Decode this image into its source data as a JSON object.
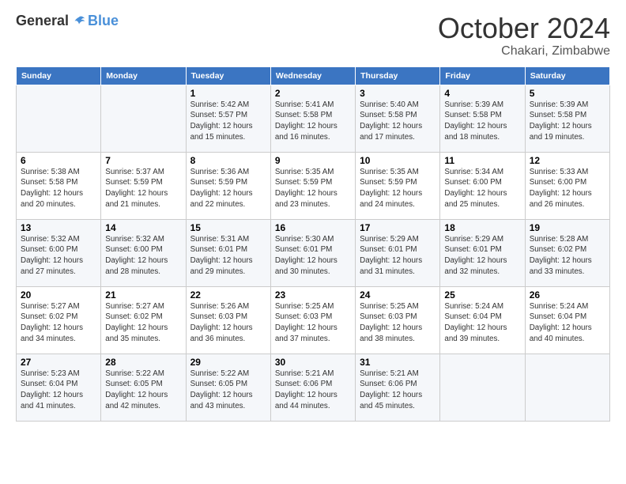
{
  "header": {
    "logo_general": "General",
    "logo_blue": "Blue",
    "month_title": "October 2024",
    "location": "Chakari, Zimbabwe"
  },
  "weekdays": [
    "Sunday",
    "Monday",
    "Tuesday",
    "Wednesday",
    "Thursday",
    "Friday",
    "Saturday"
  ],
  "weeks": [
    [
      {
        "day": "",
        "sunrise": "",
        "sunset": "",
        "daylight": ""
      },
      {
        "day": "",
        "sunrise": "",
        "sunset": "",
        "daylight": ""
      },
      {
        "day": "1",
        "sunrise": "Sunrise: 5:42 AM",
        "sunset": "Sunset: 5:57 PM",
        "daylight": "Daylight: 12 hours and 15 minutes."
      },
      {
        "day": "2",
        "sunrise": "Sunrise: 5:41 AM",
        "sunset": "Sunset: 5:58 PM",
        "daylight": "Daylight: 12 hours and 16 minutes."
      },
      {
        "day": "3",
        "sunrise": "Sunrise: 5:40 AM",
        "sunset": "Sunset: 5:58 PM",
        "daylight": "Daylight: 12 hours and 17 minutes."
      },
      {
        "day": "4",
        "sunrise": "Sunrise: 5:39 AM",
        "sunset": "Sunset: 5:58 PM",
        "daylight": "Daylight: 12 hours and 18 minutes."
      },
      {
        "day": "5",
        "sunrise": "Sunrise: 5:39 AM",
        "sunset": "Sunset: 5:58 PM",
        "daylight": "Daylight: 12 hours and 19 minutes."
      }
    ],
    [
      {
        "day": "6",
        "sunrise": "Sunrise: 5:38 AM",
        "sunset": "Sunset: 5:58 PM",
        "daylight": "Daylight: 12 hours and 20 minutes."
      },
      {
        "day": "7",
        "sunrise": "Sunrise: 5:37 AM",
        "sunset": "Sunset: 5:59 PM",
        "daylight": "Daylight: 12 hours and 21 minutes."
      },
      {
        "day": "8",
        "sunrise": "Sunrise: 5:36 AM",
        "sunset": "Sunset: 5:59 PM",
        "daylight": "Daylight: 12 hours and 22 minutes."
      },
      {
        "day": "9",
        "sunrise": "Sunrise: 5:35 AM",
        "sunset": "Sunset: 5:59 PM",
        "daylight": "Daylight: 12 hours and 23 minutes."
      },
      {
        "day": "10",
        "sunrise": "Sunrise: 5:35 AM",
        "sunset": "Sunset: 5:59 PM",
        "daylight": "Daylight: 12 hours and 24 minutes."
      },
      {
        "day": "11",
        "sunrise": "Sunrise: 5:34 AM",
        "sunset": "Sunset: 6:00 PM",
        "daylight": "Daylight: 12 hours and 25 minutes."
      },
      {
        "day": "12",
        "sunrise": "Sunrise: 5:33 AM",
        "sunset": "Sunset: 6:00 PM",
        "daylight": "Daylight: 12 hours and 26 minutes."
      }
    ],
    [
      {
        "day": "13",
        "sunrise": "Sunrise: 5:32 AM",
        "sunset": "Sunset: 6:00 PM",
        "daylight": "Daylight: 12 hours and 27 minutes."
      },
      {
        "day": "14",
        "sunrise": "Sunrise: 5:32 AM",
        "sunset": "Sunset: 6:00 PM",
        "daylight": "Daylight: 12 hours and 28 minutes."
      },
      {
        "day": "15",
        "sunrise": "Sunrise: 5:31 AM",
        "sunset": "Sunset: 6:01 PM",
        "daylight": "Daylight: 12 hours and 29 minutes."
      },
      {
        "day": "16",
        "sunrise": "Sunrise: 5:30 AM",
        "sunset": "Sunset: 6:01 PM",
        "daylight": "Daylight: 12 hours and 30 minutes."
      },
      {
        "day": "17",
        "sunrise": "Sunrise: 5:29 AM",
        "sunset": "Sunset: 6:01 PM",
        "daylight": "Daylight: 12 hours and 31 minutes."
      },
      {
        "day": "18",
        "sunrise": "Sunrise: 5:29 AM",
        "sunset": "Sunset: 6:01 PM",
        "daylight": "Daylight: 12 hours and 32 minutes."
      },
      {
        "day": "19",
        "sunrise": "Sunrise: 5:28 AM",
        "sunset": "Sunset: 6:02 PM",
        "daylight": "Daylight: 12 hours and 33 minutes."
      }
    ],
    [
      {
        "day": "20",
        "sunrise": "Sunrise: 5:27 AM",
        "sunset": "Sunset: 6:02 PM",
        "daylight": "Daylight: 12 hours and 34 minutes."
      },
      {
        "day": "21",
        "sunrise": "Sunrise: 5:27 AM",
        "sunset": "Sunset: 6:02 PM",
        "daylight": "Daylight: 12 hours and 35 minutes."
      },
      {
        "day": "22",
        "sunrise": "Sunrise: 5:26 AM",
        "sunset": "Sunset: 6:03 PM",
        "daylight": "Daylight: 12 hours and 36 minutes."
      },
      {
        "day": "23",
        "sunrise": "Sunrise: 5:25 AM",
        "sunset": "Sunset: 6:03 PM",
        "daylight": "Daylight: 12 hours and 37 minutes."
      },
      {
        "day": "24",
        "sunrise": "Sunrise: 5:25 AM",
        "sunset": "Sunset: 6:03 PM",
        "daylight": "Daylight: 12 hours and 38 minutes."
      },
      {
        "day": "25",
        "sunrise": "Sunrise: 5:24 AM",
        "sunset": "Sunset: 6:04 PM",
        "daylight": "Daylight: 12 hours and 39 minutes."
      },
      {
        "day": "26",
        "sunrise": "Sunrise: 5:24 AM",
        "sunset": "Sunset: 6:04 PM",
        "daylight": "Daylight: 12 hours and 40 minutes."
      }
    ],
    [
      {
        "day": "27",
        "sunrise": "Sunrise: 5:23 AM",
        "sunset": "Sunset: 6:04 PM",
        "daylight": "Daylight: 12 hours and 41 minutes."
      },
      {
        "day": "28",
        "sunrise": "Sunrise: 5:22 AM",
        "sunset": "Sunset: 6:05 PM",
        "daylight": "Daylight: 12 hours and 42 minutes."
      },
      {
        "day": "29",
        "sunrise": "Sunrise: 5:22 AM",
        "sunset": "Sunset: 6:05 PM",
        "daylight": "Daylight: 12 hours and 43 minutes."
      },
      {
        "day": "30",
        "sunrise": "Sunrise: 5:21 AM",
        "sunset": "Sunset: 6:06 PM",
        "daylight": "Daylight: 12 hours and 44 minutes."
      },
      {
        "day": "31",
        "sunrise": "Sunrise: 5:21 AM",
        "sunset": "Sunset: 6:06 PM",
        "daylight": "Daylight: 12 hours and 45 minutes."
      },
      {
        "day": "",
        "sunrise": "",
        "sunset": "",
        "daylight": ""
      },
      {
        "day": "",
        "sunrise": "",
        "sunset": "",
        "daylight": ""
      }
    ]
  ]
}
